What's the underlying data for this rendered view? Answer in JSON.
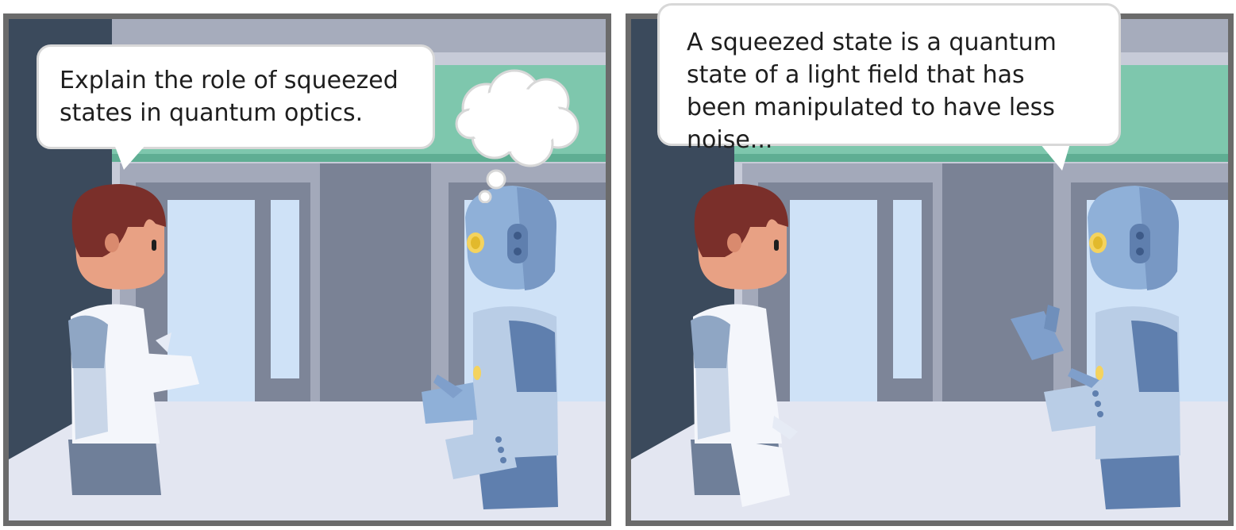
{
  "comic": {
    "panels": [
      {
        "speaker": "human",
        "bubble_type": "speech",
        "text": "Explain the role of squeezed states in quantum optics.",
        "thinking_bubble": "empty thought bubble over robot"
      },
      {
        "speaker": "robot",
        "bubble_type": "speech",
        "text": "A squeezed state is a quantum state of a light field that has been manipulated to have less noise..."
      }
    ]
  },
  "colors": {
    "frame": "#6b6b6b",
    "wall_dark": "#3b4a5c",
    "sign_green": "#7ec7ad",
    "window": "#cfe2f7",
    "floor": "#e3e6f1",
    "robot_blue": "#8fb0d8",
    "human_hair": "#7a2f2a",
    "human_skin": "#e8a184",
    "lab_coat": "#f4f6fb"
  }
}
